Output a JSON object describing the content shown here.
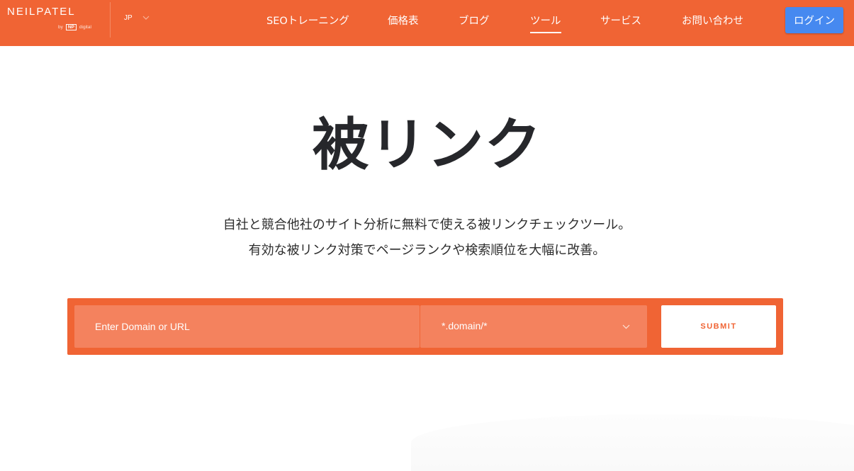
{
  "header": {
    "logo": {
      "wordmark": "NEILPATEL",
      "by": "by",
      "np": "NP",
      "digital": "digital"
    },
    "language": "JP",
    "nav": [
      {
        "label": "SEOトレーニング",
        "active": false
      },
      {
        "label": "価格表",
        "active": false
      },
      {
        "label": "ブログ",
        "active": false
      },
      {
        "label": "ツール",
        "active": true
      },
      {
        "label": "サービス",
        "active": false
      },
      {
        "label": "お問い合わせ",
        "active": false
      }
    ],
    "login_label": "ログイン"
  },
  "hero": {
    "title": "被リンク",
    "subtitle_line1": "自社と競合他社のサイト分析に無料で使える被リンクチェックツール。",
    "subtitle_line2": "有効な被リンク対策でページランクや検索順位を大幅に改善。"
  },
  "search": {
    "url_placeholder": "Enter Domain or URL",
    "url_value": "",
    "mode_selected": "*.domain/*",
    "submit_label": "SUBMIT"
  },
  "colors": {
    "brand_orange": "#f06434",
    "input_orange": "#f4825e",
    "login_blue": "#4689f0",
    "title_dark": "#26272b"
  }
}
